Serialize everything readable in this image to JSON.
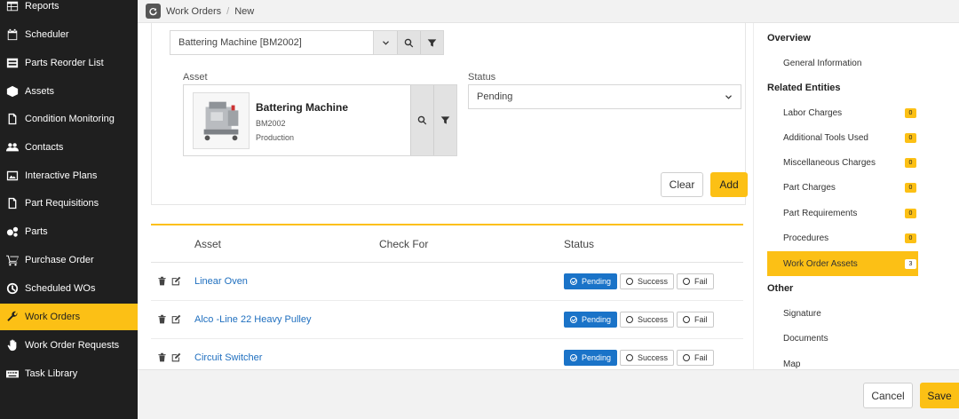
{
  "sidebar": {
    "items": [
      {
        "label": "Reports",
        "icon": "table-icon"
      },
      {
        "label": "Scheduler",
        "icon": "calendar-icon"
      },
      {
        "label": "Parts Reorder List",
        "icon": "list-icon"
      },
      {
        "label": "Assets",
        "icon": "cube-icon"
      },
      {
        "label": "Condition Monitoring",
        "icon": "document-icon"
      },
      {
        "label": "Contacts",
        "icon": "users-icon"
      },
      {
        "label": "Interactive Plans",
        "icon": "image-icon"
      },
      {
        "label": "Part Requisitions",
        "icon": "document-icon"
      },
      {
        "label": "Parts",
        "icon": "gears-icon"
      },
      {
        "label": "Purchase Order",
        "icon": "cart-icon"
      },
      {
        "label": "Scheduled WOs",
        "icon": "clock-icon"
      },
      {
        "label": "Work Orders",
        "icon": "wrench-icon",
        "active": true
      },
      {
        "label": "Work Order Requests",
        "icon": "hand-icon"
      },
      {
        "label": "Task Library",
        "icon": "keyboard-icon"
      }
    ]
  },
  "breadcrumb": {
    "items": [
      "Work Orders",
      "New"
    ],
    "separator": "/"
  },
  "form": {
    "asset_select_value": "Battering Machine [BM2002]",
    "asset_label": "Asset",
    "status_label": "Status",
    "status_value": "Pending",
    "asset": {
      "name": "Battering Machine",
      "code": "BM2002",
      "department": "Production"
    },
    "clear_label": "Clear",
    "add_label": "Add"
  },
  "table": {
    "headers": {
      "asset": "Asset",
      "check_for": "Check For",
      "status": "Status"
    },
    "status_options": [
      "Pending",
      "Success",
      "Fail"
    ],
    "rows": [
      {
        "asset": "Linear Oven",
        "status": "Pending"
      },
      {
        "asset": "Alco -Line 22 Heavy Pulley",
        "status": "Pending"
      },
      {
        "asset": "Circuit Switcher",
        "status": "Pending"
      }
    ]
  },
  "right_panel": {
    "overview": "Overview",
    "general_information": "General Information",
    "related_entities": "Related Entities",
    "entities": [
      {
        "label": "Labor Charges",
        "count": "0"
      },
      {
        "label": "Additional Tools Used",
        "count": "0"
      },
      {
        "label": "Miscellaneous Charges",
        "count": "0"
      },
      {
        "label": "Part Charges",
        "count": "0"
      },
      {
        "label": "Part Requirements",
        "count": "0"
      },
      {
        "label": "Procedures",
        "count": "0"
      },
      {
        "label": "Work Order Assets",
        "count": "3",
        "active": true
      }
    ],
    "other": "Other",
    "other_items": [
      "Signature",
      "Documents",
      "Map"
    ]
  },
  "footer": {
    "cancel_label": "Cancel",
    "save_label": "Save"
  },
  "colors": {
    "accent": "#fcc015",
    "sidebar_bg": "#1f1f1f",
    "link": "#1f6fbf",
    "pending_active": "#1a73c8"
  }
}
